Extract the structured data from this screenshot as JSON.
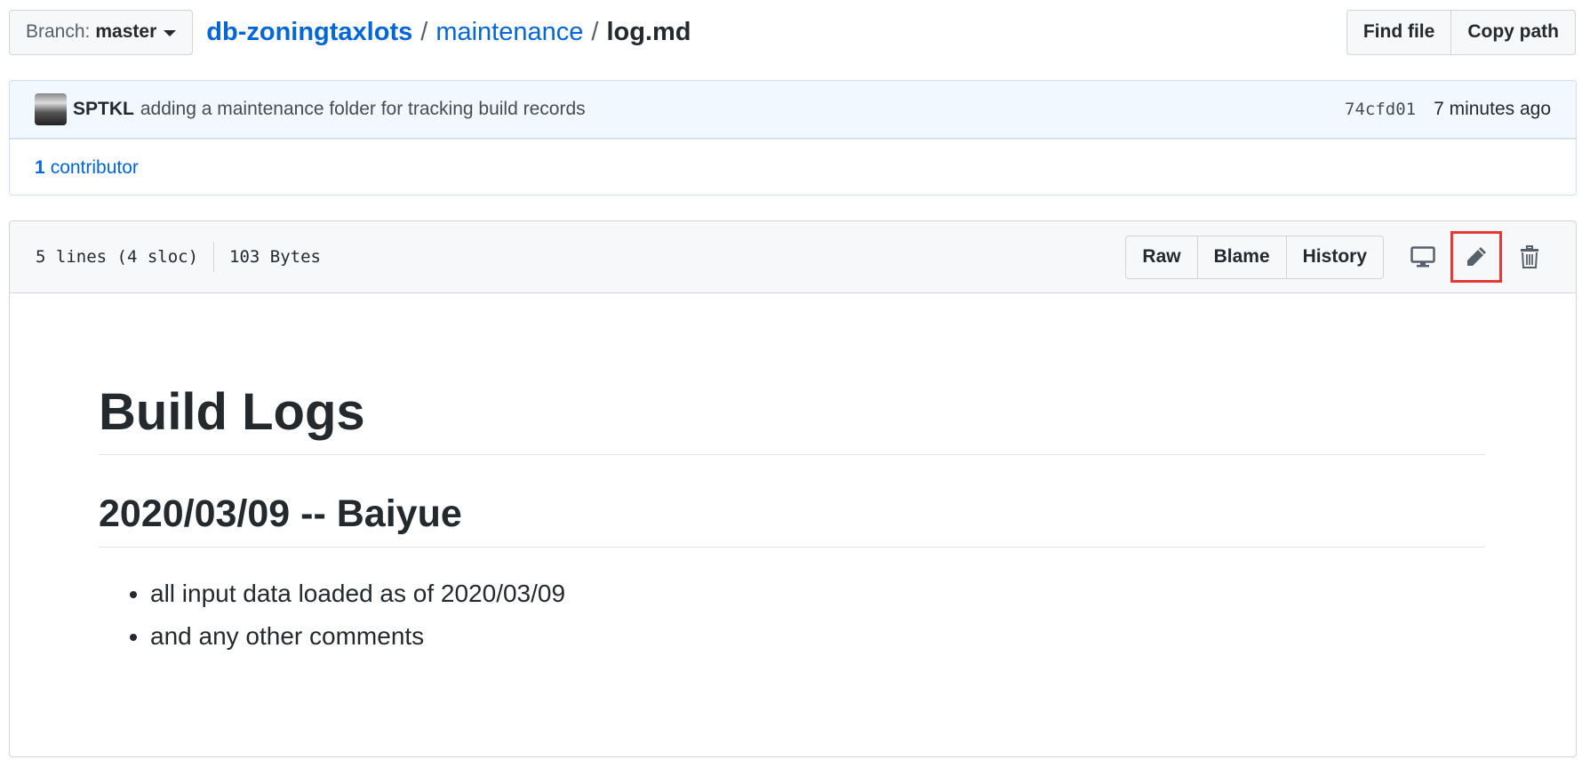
{
  "branch": {
    "prefix": "Branch:",
    "name": "master"
  },
  "breadcrumb": {
    "repo": "db-zoningtaxlots",
    "sep1": "/",
    "folder": "maintenance",
    "sep2": "/",
    "file": "log.md"
  },
  "top_actions": {
    "find_file": "Find file",
    "copy_path": "Copy path"
  },
  "commit": {
    "author": "SPTKL",
    "message": "adding a maintenance folder for tracking build records",
    "sha": "74cfd01",
    "time": "7 minutes ago"
  },
  "contributors": {
    "count": "1",
    "label": "contributor"
  },
  "file": {
    "lines": "5 lines (4 sloc)",
    "size": "103 Bytes",
    "actions": {
      "raw": "Raw",
      "blame": "Blame",
      "history": "History"
    },
    "icons": [
      "desktop-icon",
      "pencil-icon",
      "trash-icon"
    ]
  },
  "content": {
    "h1": "Build Logs",
    "h2": "2020/03/09 -- Baiyue",
    "items": [
      "all input data loaded as of 2020/03/09",
      "and any other comments"
    ]
  },
  "colors": {
    "link": "#0366d6",
    "highlight": "#e53935"
  }
}
